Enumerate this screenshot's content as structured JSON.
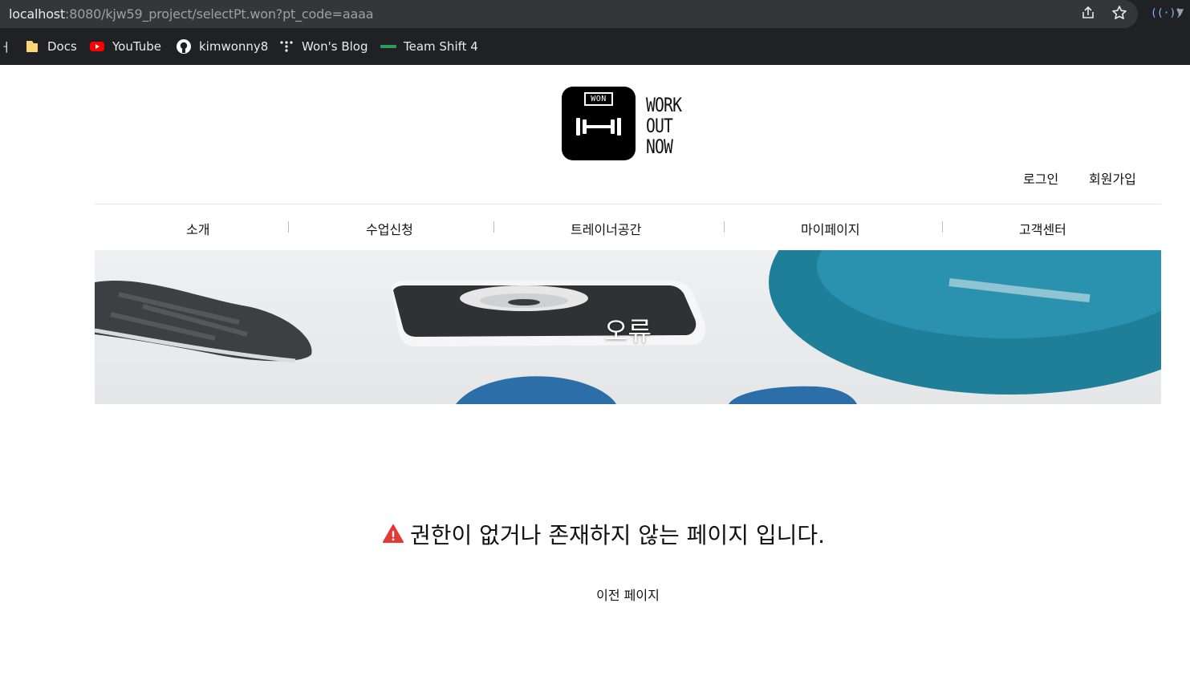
{
  "browser": {
    "url_host": "localhost",
    "url_rest": ":8080/kjw59_project/selectPt.won?pt_code=aaaa",
    "bookmarks_clipped_prefix": "ㅓ",
    "bookmarks": [
      {
        "label": "Docs",
        "icon": "folder-icon",
        "color": "#f9d776"
      },
      {
        "label": "YouTube",
        "icon": "youtube-icon",
        "color": "#ff0000"
      },
      {
        "label": "kimwonny8",
        "icon": "github-icon",
        "color": "#ffffff"
      },
      {
        "label": "Won's Blog",
        "icon": "blog-icon",
        "color": "#ffffff"
      },
      {
        "label": "Team Shift 4",
        "icon": "team-icon",
        "color": "#2e9a5c"
      }
    ]
  },
  "site": {
    "logo_badge": "WON",
    "logo_lines": [
      "WORK",
      "OUT",
      "NOW"
    ],
    "auth": {
      "login": "로그인",
      "signup": "회원가입"
    },
    "nav": [
      "소개",
      "수업신청",
      "트레이너공간",
      "마이페이지",
      "고객센터"
    ]
  },
  "hero": {
    "title": "오류"
  },
  "error": {
    "message": "권한이 없거나 존재하지 않는 페이지 입니다.",
    "back_label": "이전 페이지",
    "icon": "warning-icon",
    "icon_color": "#e53935"
  }
}
